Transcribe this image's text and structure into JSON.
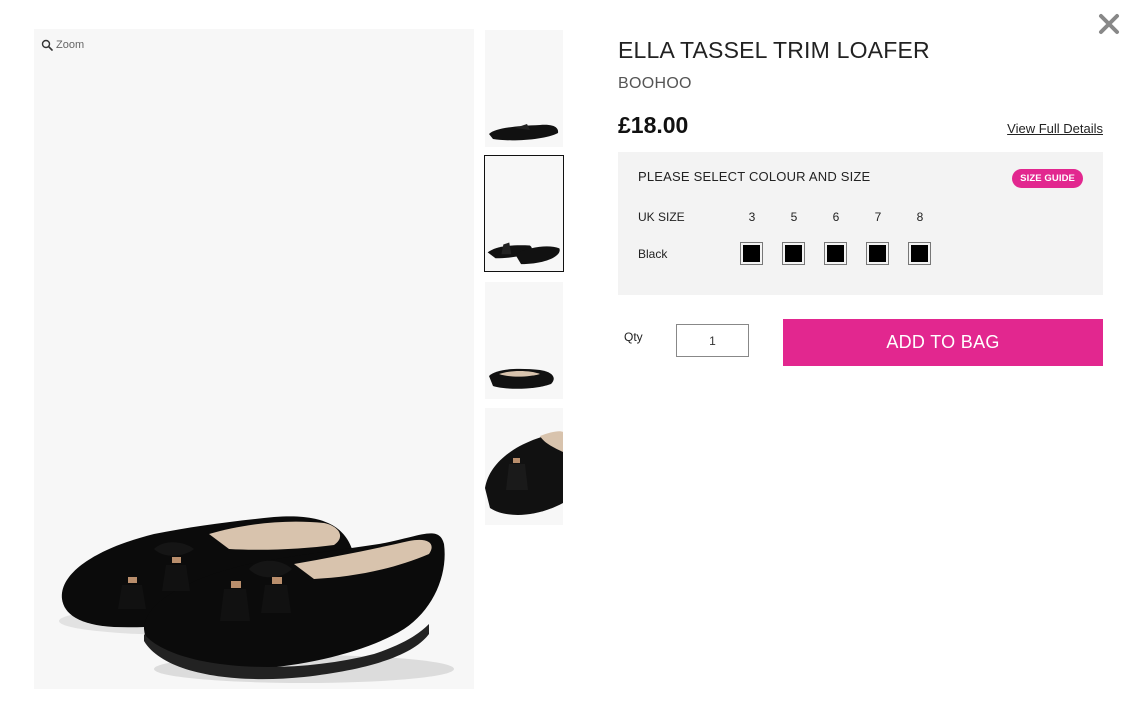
{
  "product": {
    "title": "ELLA TASSEL TRIM LOAFER",
    "brand": "BOOHOO",
    "price": "£18.00",
    "details_link": "View Full Details"
  },
  "gallery": {
    "zoom_label": "Zoom",
    "thumbnails_count": 4,
    "selected_thumbnail": 2
  },
  "selector": {
    "title": "PLEASE SELECT COLOUR AND SIZE",
    "size_guide": "SIZE GUIDE",
    "size_label": "UK SIZE",
    "sizes": [
      "3",
      "5",
      "6",
      "7",
      "8"
    ],
    "colour": "Black",
    "swatch_color": "#000000"
  },
  "purchase": {
    "qty_label": "Qty",
    "qty_value": "1",
    "add_button": "ADD TO BAG"
  },
  "colors": {
    "accent": "#e2278f",
    "panel_bg": "#f3f3f3"
  },
  "icons": {
    "close": "close-icon",
    "zoom": "magnifier-icon"
  }
}
